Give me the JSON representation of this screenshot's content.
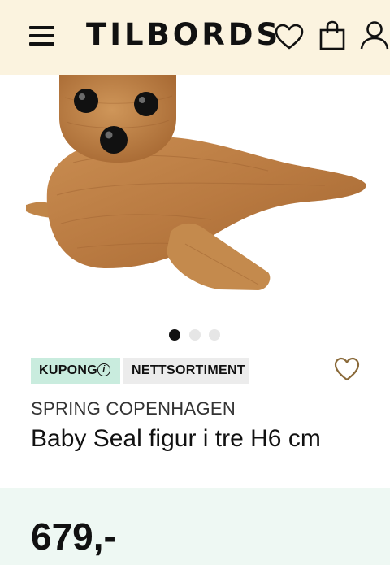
{
  "header": {
    "logo": "TILBORDS",
    "background": "#fbf3df",
    "icons": [
      "menu-icon",
      "heart-icon",
      "shopping-bag-icon",
      "user-icon"
    ]
  },
  "gallery": {
    "image": "wooden-baby-seal-figure",
    "slides_total": 3,
    "active_slide": 1
  },
  "badges": {
    "coupon": "KUPONG",
    "coupon_color": "#c9ecde",
    "online_only": "NETTSORTIMENT",
    "online_color": "#ececec"
  },
  "product": {
    "brand": "SPRING COPENHAGEN",
    "title": "Baby Seal figur i tre H6 cm",
    "price": "679,-",
    "price_panel_color": "#eef8f3"
  }
}
